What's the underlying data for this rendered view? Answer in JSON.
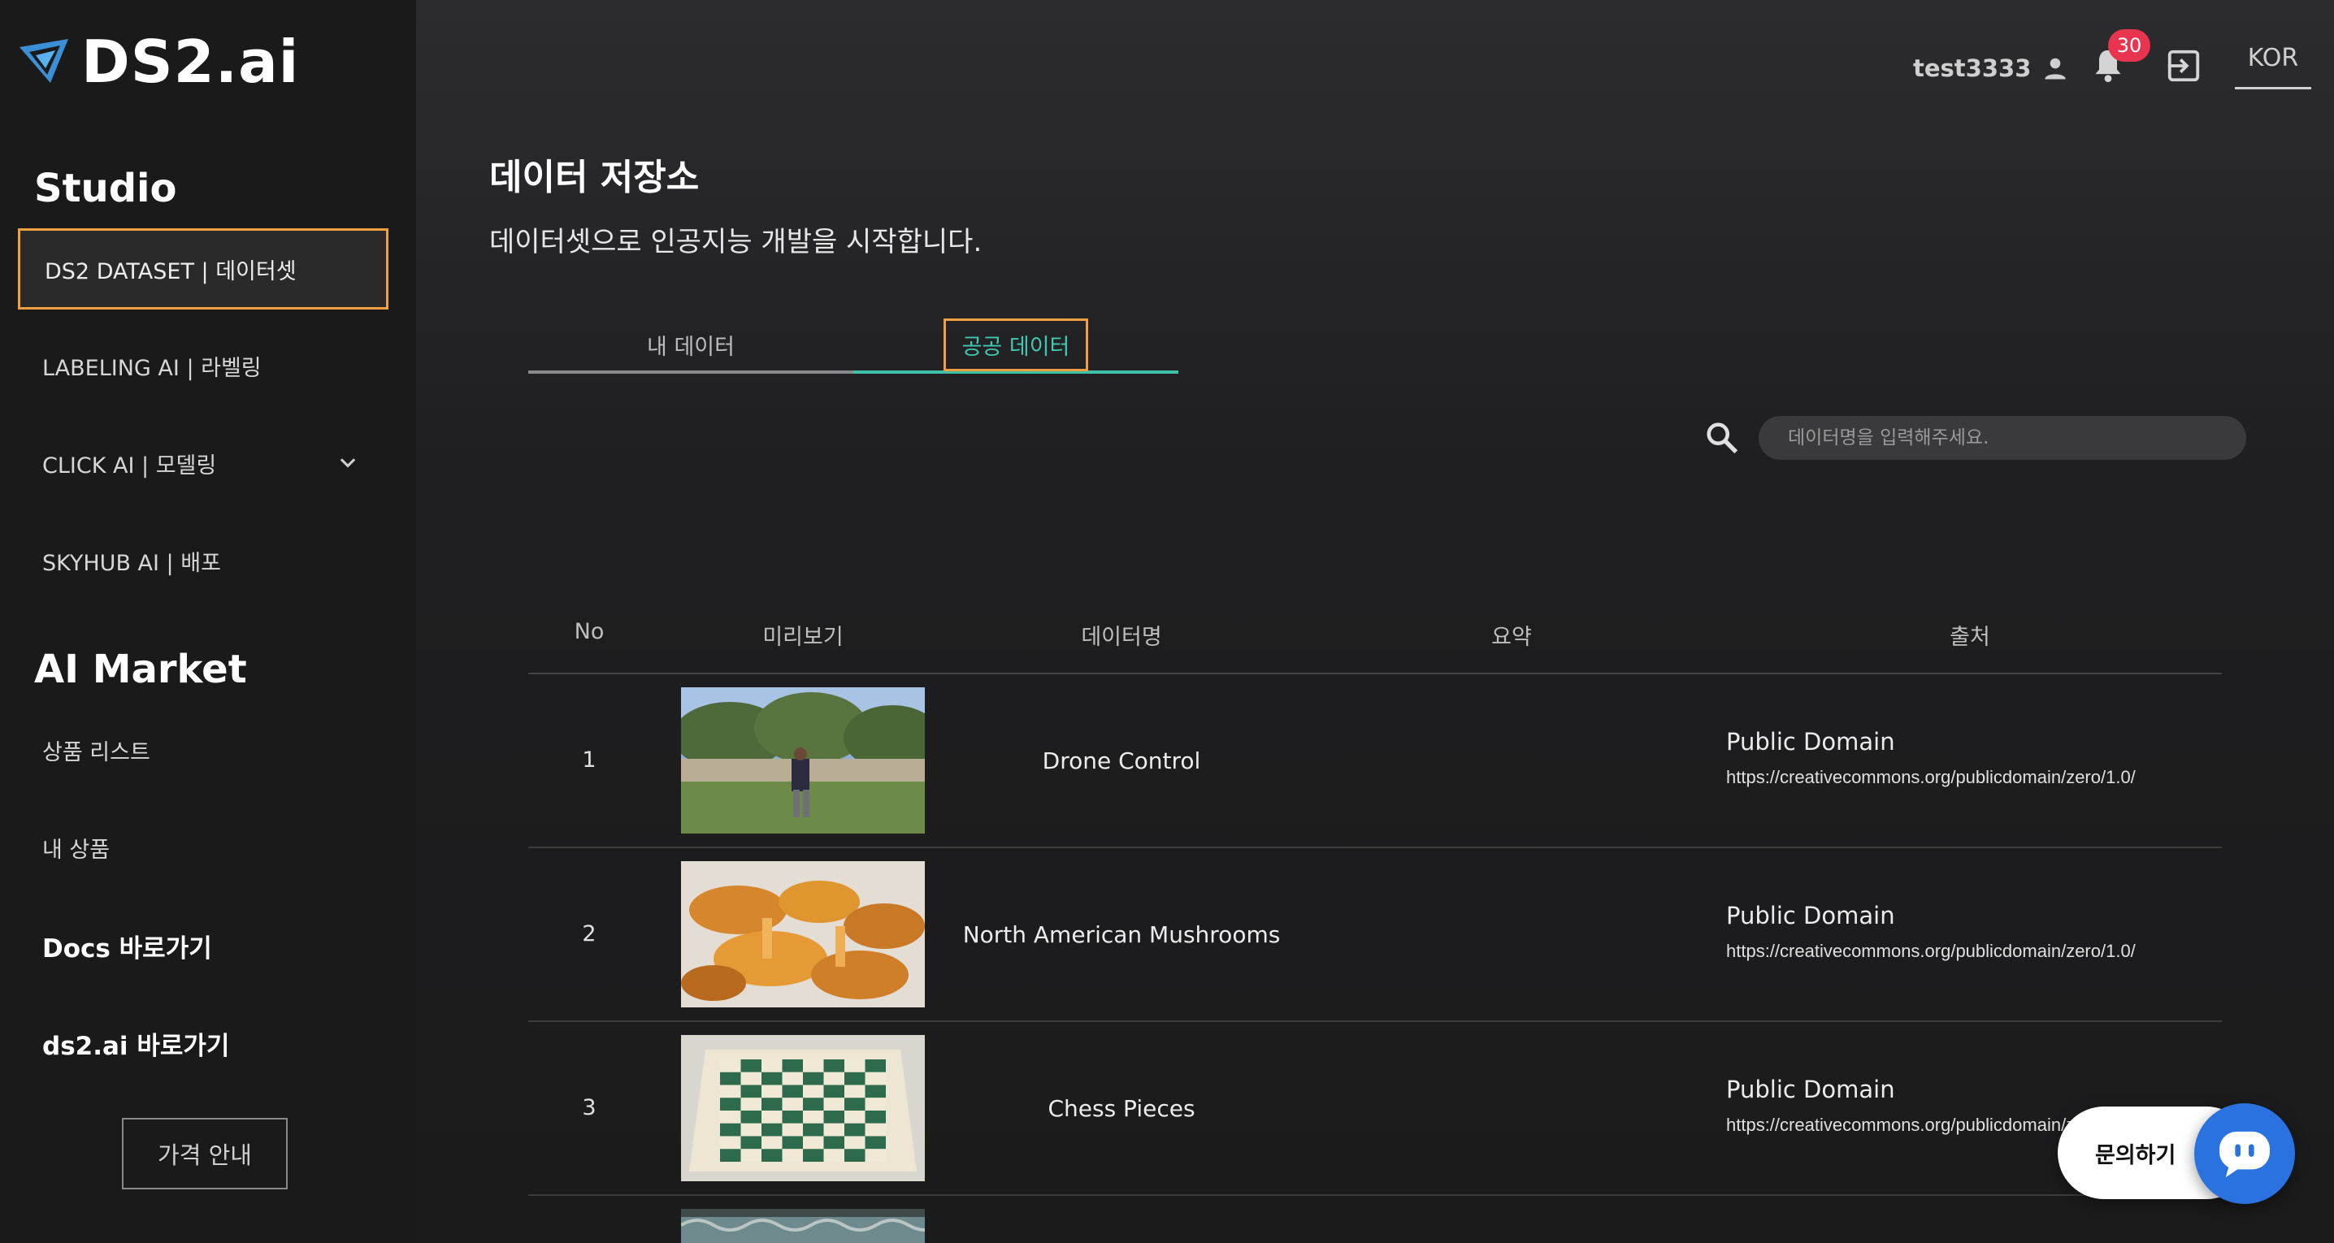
{
  "brand": {
    "name": "DS2.ai",
    "accent_color": "#3a8fd6"
  },
  "sidebar": {
    "studio_title": "Studio",
    "studio_items": [
      {
        "label": "DS2 DATASET | 데이터셋",
        "active": true
      },
      {
        "label": "LABELING AI | 라벨링"
      },
      {
        "label": "CLICK AI | 모델링",
        "icon": "chevron-down-icon"
      },
      {
        "label": "SKYHUB AI | 배포"
      }
    ],
    "market_title": "AI Market",
    "market_items": [
      {
        "label": "상품 리스트"
      },
      {
        "label": "내 상품"
      }
    ],
    "links": [
      {
        "label": "Docs 바로가기"
      },
      {
        "label": "ds2.ai 바로가기"
      }
    ],
    "price_button": "가격 안내"
  },
  "topbar": {
    "username": "test3333",
    "notification_count": "30",
    "language": "KOR"
  },
  "page": {
    "title": "데이터 저장소",
    "subtitle": "데이터셋으로 인공지능 개발을 시작합니다."
  },
  "tabs": [
    {
      "label": "내 데이터",
      "active": false
    },
    {
      "label": "공공 데이터",
      "active": true
    }
  ],
  "search": {
    "placeholder": "데이터명을 입력해주세요."
  },
  "table": {
    "columns": [
      "No",
      "미리보기",
      "데이터명",
      "요약",
      "출처"
    ],
    "rows": [
      {
        "no": "1",
        "name": "Drone Control",
        "source": "Public Domain",
        "url": "https://creativecommons.org/publicdomain/zero/1.0/",
        "preview": "person-outdoors-image"
      },
      {
        "no": "2",
        "name": "North American Mushrooms",
        "source": "Public Domain",
        "url": "https://creativecommons.org/publicdomain/zero/1.0/",
        "preview": "mushrooms-image"
      },
      {
        "no": "3",
        "name": "Chess Pieces",
        "source": "Public Domain",
        "url": "https://creativecommons.org/publicdomain/zero/1.0/",
        "preview": "chessboard-image"
      }
    ]
  },
  "chat": {
    "label": "문의하기"
  },
  "colors": {
    "active_tab": "#3fc1a8",
    "highlight_border": "#f0a040",
    "badge": "#e8344f",
    "chat_button": "#2a72e0"
  }
}
